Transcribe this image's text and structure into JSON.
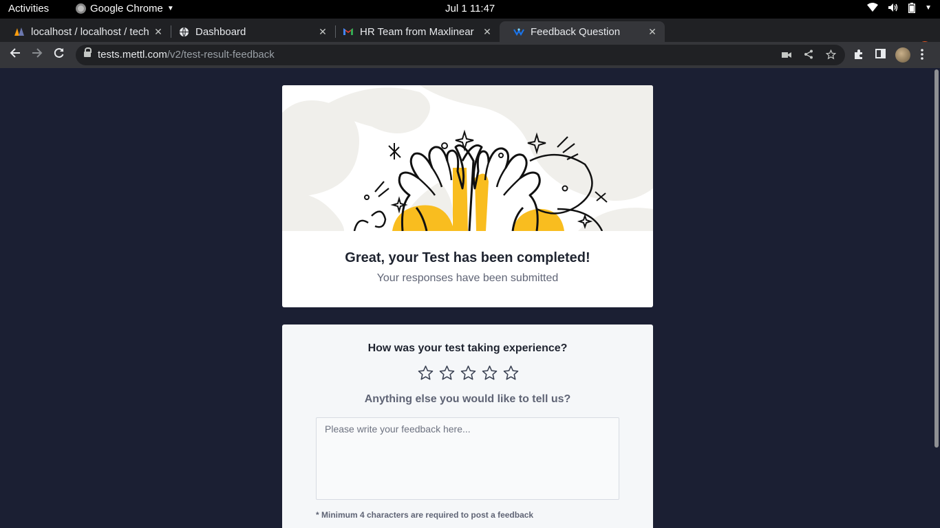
{
  "system_bar": {
    "activities": "Activities",
    "app_name": "Google Chrome",
    "clock": "Jul 1  11:47"
  },
  "tabs": [
    {
      "title": "localhost / localhost / tech",
      "favicon": "phpmyadmin-icon",
      "active": false
    },
    {
      "title": "Dashboard",
      "favicon": "globe-icon",
      "active": false
    },
    {
      "title": "HR Team from Maxlinear",
      "favicon": "gmail-icon",
      "active": false
    },
    {
      "title": "Feedback Question",
      "favicon": "mettl-icon",
      "active": true
    }
  ],
  "address_bar": {
    "host": "tests.mettl.com",
    "path": "/v2/test-result-feedback"
  },
  "result_card": {
    "heading": "Great, your Test has been completed!",
    "subheading": "Your responses have been submitted"
  },
  "feedback_card": {
    "question": "How was your test taking experience?",
    "rating_max": 5,
    "rating_value": 0,
    "prompt": "Anything else you would like to tell us?",
    "textarea_placeholder": "Please write your feedback here...",
    "textarea_value": "",
    "note": "* Minimum 4 characters are required to post a feedback"
  },
  "colors": {
    "page_bg": "#1b1f33",
    "accent_yellow": "#f9bd1f",
    "blob_gray": "#f0efeb"
  }
}
